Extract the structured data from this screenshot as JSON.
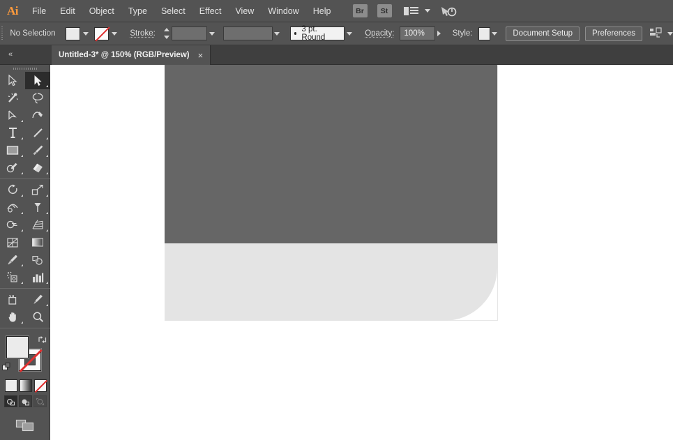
{
  "app": {
    "name": "Adobe Illustrator",
    "logo_text": "Ai"
  },
  "menubar": {
    "items": [
      {
        "label": "File"
      },
      {
        "label": "Edit"
      },
      {
        "label": "Object"
      },
      {
        "label": "Type"
      },
      {
        "label": "Select"
      },
      {
        "label": "Effect"
      },
      {
        "label": "View"
      },
      {
        "label": "Window"
      },
      {
        "label": "Help"
      }
    ],
    "bridge_label": "Br",
    "stock_label": "St",
    "workspace_icon": "workspace-switcher-icon",
    "workspace_chevron": "chevron-down-icon",
    "search_icon": "cursor-power-icon"
  },
  "controlbar": {
    "selection_status": "No Selection",
    "fill_swatch": {
      "name": "fill-swatch",
      "color": "#ebebeb"
    },
    "stroke_swatch": {
      "name": "stroke-swatch",
      "color": "none"
    },
    "stroke_label": "Stroke:",
    "stroke_weight_value": "",
    "variable_width_value": "",
    "brush_definition": "3 pt. Round",
    "opacity_label": "Opacity:",
    "opacity_value": "100%",
    "style_label": "Style:",
    "style_swatch_color": "#ebebeb",
    "document_setup_label": "Document Setup",
    "preferences_label": "Preferences",
    "align_icon": "align-objects-icon"
  },
  "tabbar": {
    "collapse_icon": "«",
    "document_title": "Untitled-3* @ 150% (RGB/Preview)",
    "close_label": "×"
  },
  "toolbar": {
    "tools": [
      {
        "name": "selection-tool",
        "label": "Selection",
        "active": false,
        "corner": false
      },
      {
        "name": "direct-selection-tool",
        "label": "Direct Selection",
        "active": true,
        "corner": true
      },
      {
        "name": "magic-wand-tool",
        "label": "Magic Wand",
        "active": false,
        "corner": false
      },
      {
        "name": "lasso-tool",
        "label": "Lasso",
        "active": false,
        "corner": false
      },
      {
        "name": "pen-tool",
        "label": "Pen",
        "active": false,
        "corner": true
      },
      {
        "name": "curvature-tool",
        "label": "Curvature",
        "active": false,
        "corner": false
      },
      {
        "name": "type-tool",
        "label": "Type",
        "active": false,
        "corner": true
      },
      {
        "name": "line-segment-tool",
        "label": "Line Segment",
        "active": false,
        "corner": true
      },
      {
        "name": "rectangle-tool",
        "label": "Rectangle",
        "active": false,
        "corner": true
      },
      {
        "name": "paintbrush-tool",
        "label": "Paintbrush",
        "active": false,
        "corner": true
      },
      {
        "name": "shaper-tool",
        "label": "Shaper",
        "active": false,
        "corner": true
      },
      {
        "name": "eraser-tool",
        "label": "Eraser",
        "active": false,
        "corner": true
      },
      {
        "name": "rotate-tool",
        "label": "Rotate",
        "active": false,
        "corner": true
      },
      {
        "name": "scale-tool",
        "label": "Scale",
        "active": false,
        "corner": true
      },
      {
        "name": "width-tool",
        "label": "Width",
        "active": false,
        "corner": true
      },
      {
        "name": "free-transform-tool",
        "label": "Free Transform",
        "active": false,
        "corner": true
      },
      {
        "name": "shape-builder-tool",
        "label": "Shape Builder",
        "active": false,
        "corner": true
      },
      {
        "name": "perspective-grid-tool",
        "label": "Perspective Grid",
        "active": false,
        "corner": true
      },
      {
        "name": "mesh-tool",
        "label": "Mesh",
        "active": false,
        "corner": false
      },
      {
        "name": "gradient-tool",
        "label": "Gradient",
        "active": false,
        "corner": false
      },
      {
        "name": "eyedropper-tool",
        "label": "Eyedropper",
        "active": false,
        "corner": true
      },
      {
        "name": "blend-tool",
        "label": "Blend",
        "active": false,
        "corner": false
      },
      {
        "name": "symbol-sprayer-tool",
        "label": "Symbol Sprayer",
        "active": false,
        "corner": true
      },
      {
        "name": "column-graph-tool",
        "label": "Column Graph",
        "active": false,
        "corner": true
      },
      {
        "name": "artboard-tool",
        "label": "Artboard",
        "active": false,
        "corner": false
      },
      {
        "name": "slice-tool",
        "label": "Slice",
        "active": false,
        "corner": true
      },
      {
        "name": "hand-tool",
        "label": "Hand",
        "active": false,
        "corner": true
      },
      {
        "name": "zoom-tool",
        "label": "Zoom",
        "active": false,
        "corner": false
      }
    ],
    "fill_color": "#ebebeb",
    "stroke_color": "none",
    "swap_icon": "swap-fill-stroke-icon",
    "default_icon": "default-fill-stroke-icon",
    "paint_modes": [
      {
        "name": "color-mode-button",
        "label": "Color"
      },
      {
        "name": "gradient-mode-button",
        "label": "Gradient"
      },
      {
        "name": "none-mode-button",
        "label": "None"
      }
    ],
    "draw_modes": [
      {
        "name": "draw-normal-button",
        "label": "Draw Normal",
        "selected": true,
        "disabled": false
      },
      {
        "name": "draw-behind-button",
        "label": "Draw Behind",
        "selected": false,
        "disabled": false
      },
      {
        "name": "draw-inside-button",
        "label": "Draw Inside",
        "selected": false,
        "disabled": true
      }
    ],
    "screen_mode": {
      "name": "change-screen-mode-button",
      "label": "Change Screen Mode"
    }
  },
  "canvas": {
    "artboard_label": "artboard",
    "shapes": [
      {
        "name": "dark-rectangle-shape",
        "color": "#666666"
      },
      {
        "name": "light-rounded-shape",
        "color": "#e4e4e4"
      }
    ]
  }
}
